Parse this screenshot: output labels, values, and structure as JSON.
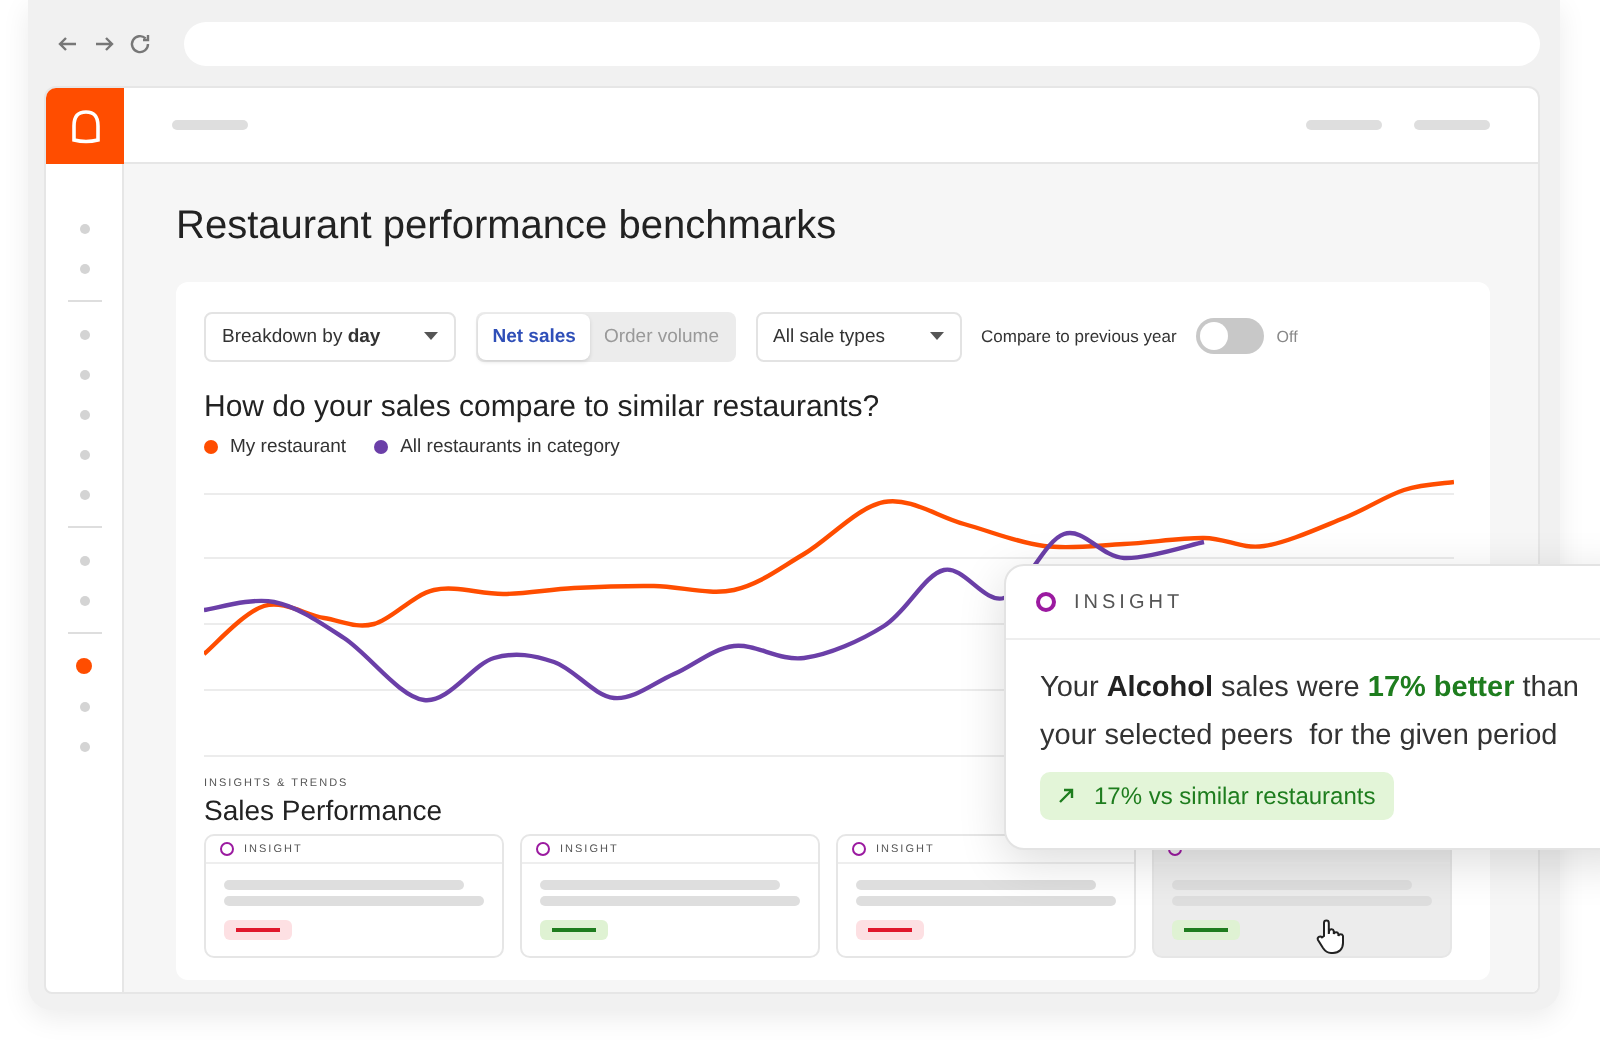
{
  "page": {
    "title": "Restaurant performance benchmarks"
  },
  "sidebar": {
    "groups": [
      [
        {
          "selected": false
        },
        {
          "selected": false
        }
      ],
      [
        {
          "selected": false
        },
        {
          "selected": false
        },
        {
          "selected": false
        },
        {
          "selected": false
        },
        {
          "selected": false
        }
      ],
      [
        {
          "selected": false
        },
        {
          "selected": false
        }
      ],
      [
        {
          "selected": true
        },
        {
          "selected": false
        },
        {
          "selected": false
        }
      ]
    ]
  },
  "filters": {
    "breakdown": "Breakdown by **day**",
    "metric_tabs": [
      {
        "label": "Net sales",
        "selected": true
      },
      {
        "label": "Order volume",
        "selected": false
      }
    ],
    "sale_types": "All sale types",
    "compare": {
      "label": "Compare to previous year",
      "on": false,
      "state_text": "Off"
    }
  },
  "chart": {
    "question": "How do your sales compare to similar restaurants?",
    "legend": [
      {
        "label": "My restaurant",
        "color": "#ff4d00"
      },
      {
        "label": "All restaurants in category",
        "color": "#6b3fa8"
      }
    ]
  },
  "section": {
    "eyebrow": "INSIGHTS & TRENDS",
    "title": "Sales Performance"
  },
  "insight_cards": [
    {
      "label": "INSIGHT",
      "kind": "down"
    },
    {
      "label": "INSIGHT",
      "kind": "up"
    },
    {
      "label": "INSIGHT",
      "kind": "down"
    },
    {
      "kind": "up",
      "dimmed": true
    }
  ],
  "insight_popup": {
    "label": "INSIGHT",
    "message": [
      {
        "text": "Your ",
        "kind": "plain"
      },
      {
        "text": "Alcohol",
        "kind": "bold"
      },
      {
        "text": " sales were ",
        "kind": "plain"
      },
      {
        "text": "17% better",
        "kind": "highlight"
      },
      {
        "text": " than your selected peers  for the given period",
        "kind": "plain"
      }
    ],
    "badge": "17% vs similar restaurants"
  }
}
